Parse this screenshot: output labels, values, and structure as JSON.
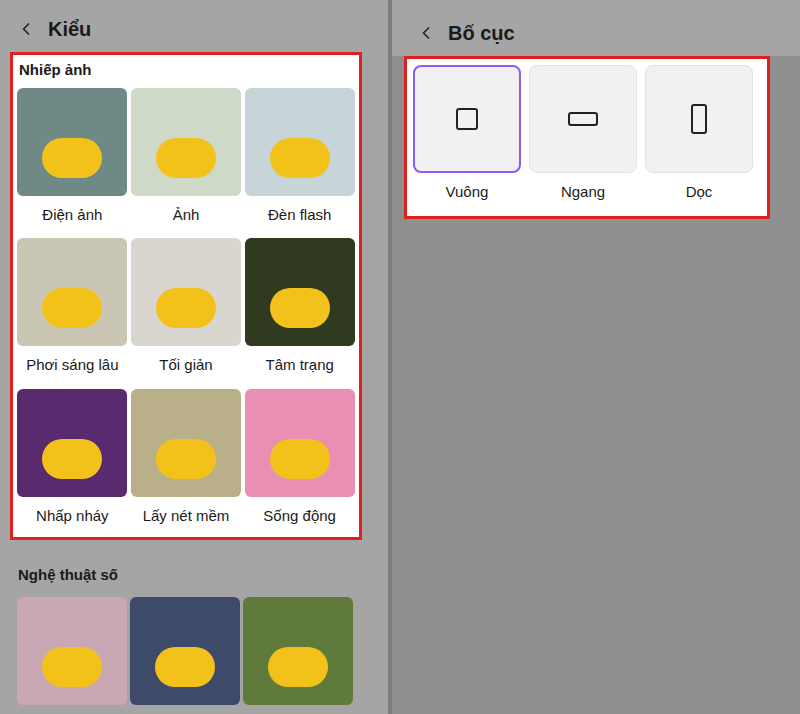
{
  "style_panel": {
    "title": "Kiểu",
    "sections": [
      {
        "title": "Nhiếp ảnh",
        "items": [
          {
            "label": "Điện ảnh"
          },
          {
            "label": "Ảnh"
          },
          {
            "label": "Đèn flash"
          },
          {
            "label": "Phơi sáng lâu"
          },
          {
            "label": "Tối giản"
          },
          {
            "label": "Tâm trạng"
          },
          {
            "label": "Nhấp nháy"
          },
          {
            "label": "Lấy nét mềm"
          },
          {
            "label": "Sống động"
          }
        ]
      },
      {
        "title": "Nghệ thuật số",
        "items": [
          {
            "label": ""
          },
          {
            "label": ""
          },
          {
            "label": ""
          }
        ]
      }
    ]
  },
  "layout_panel": {
    "title": "Bố cục",
    "options": [
      {
        "label": "Vuông",
        "kind": "square",
        "selected": true
      },
      {
        "label": "Ngang",
        "kind": "horizontal",
        "selected": false
      },
      {
        "label": "Dọc",
        "kind": "vertical",
        "selected": false
      }
    ]
  }
}
